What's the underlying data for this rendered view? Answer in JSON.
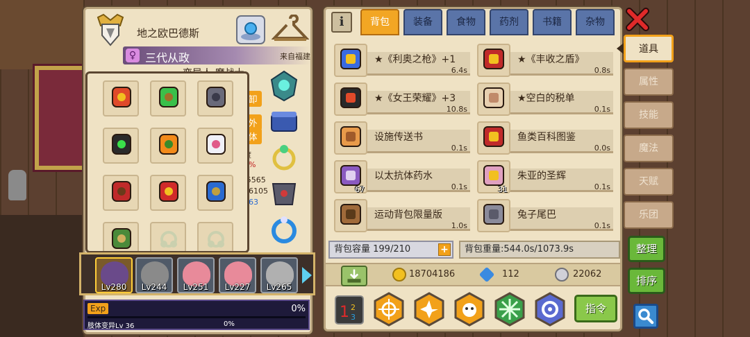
{
  "character": {
    "name": "地之欧巴德斯",
    "title": "三代从政",
    "origin": "来自福建",
    "subtitle": "变异人 魔战士",
    "stat_tags": [
      "卸",
      "外",
      "体"
    ],
    "stat_lines": [
      "度",
      "0%",
      "/5565",
      "26105",
      "263"
    ]
  },
  "equipment_slots": [
    {
      "icon": "flame-sword-icon"
    },
    {
      "icon": "green-staff-icon"
    },
    {
      "icon": "iron-gauntlet-icon"
    },
    {
      "icon": "dark-ring-icon"
    },
    {
      "icon": "pumpkin-icon"
    },
    {
      "icon": "white-glove-icon"
    },
    {
      "icon": "red-belt-icon"
    },
    {
      "icon": "red-boot-icon"
    },
    {
      "icon": "blue-boot-icon"
    },
    {
      "icon": "green-helmet-icon"
    },
    {
      "icon": "empty-slot-icon"
    },
    {
      "icon": "empty-slot-icon"
    }
  ],
  "heroes": [
    {
      "level": "Lv280",
      "selected": true,
      "color": "#6a4a8a"
    },
    {
      "level": "Lv244",
      "selected": false,
      "color": "#8a8a8a"
    },
    {
      "level": "Lv251",
      "selected": false,
      "color": "#e88a9a"
    },
    {
      "level": "Lv227",
      "selected": false,
      "color": "#e88a9a"
    },
    {
      "level": "Lv265",
      "selected": false,
      "color": "#b0b0b0"
    }
  ],
  "exp": {
    "label": "Exp",
    "percent": "0%",
    "fill": 0,
    "limb_text": "肢体变异Lv 36",
    "limb_percent": "0%"
  },
  "inventory": {
    "info_icon": "i",
    "tabs": [
      "背包",
      "装备",
      "食物",
      "药剂",
      "书籍",
      "杂物"
    ],
    "active_tab": 0,
    "items": [
      {
        "name": "★《利奥之枪》+1",
        "weight": "6.4s",
        "count": "",
        "icon": "blaster-icon"
      },
      {
        "name": "★《丰收之盾》",
        "weight": "0.8s",
        "count": "",
        "icon": "red-shield-icon"
      },
      {
        "name": "★《女王荣耀》+3",
        "weight": "10.8s",
        "count": "",
        "icon": "queen-shield-icon"
      },
      {
        "name": "★空白的税单",
        "weight": "0.1s",
        "count": "",
        "icon": "tax-form-icon"
      },
      {
        "name": "设施传送书",
        "weight": "0.1s",
        "count": "",
        "icon": "teleport-book-icon"
      },
      {
        "name": "鱼类百科图鉴",
        "weight": "0.0s",
        "count": "",
        "icon": "fish-encyclopedia-icon"
      },
      {
        "name": "以太抗体药水",
        "weight": "0.1s",
        "count": "67",
        "icon": "potion-icon"
      },
      {
        "name": "朱亚的圣辉",
        "weight": "0.1s",
        "count": "31",
        "icon": "holy-flask-icon"
      },
      {
        "name": "运动背包限量版",
        "weight": "1.0s",
        "count": "",
        "icon": "backpack-icon"
      },
      {
        "name": "兔子尾巴",
        "weight": "0.1s",
        "count": "",
        "icon": "rabbit-tail-icon"
      }
    ],
    "capacity": "背包容量 199/210",
    "weight": "背包重量:544.0s/1073.9s",
    "gold": "18704186",
    "diamonds": "112",
    "silver": "22062",
    "command_label": "指令"
  },
  "side_tabs": [
    "道具",
    "属性",
    "技能",
    "魔法",
    "天赋",
    "乐团"
  ],
  "side_buttons": {
    "organize": "整理",
    "sort": "排序"
  },
  "colors": {
    "panel": "#efe2c4",
    "accent_orange": "#f2a11a",
    "tab_blue": "#5a74a8",
    "action_green": "#6ab83a"
  }
}
